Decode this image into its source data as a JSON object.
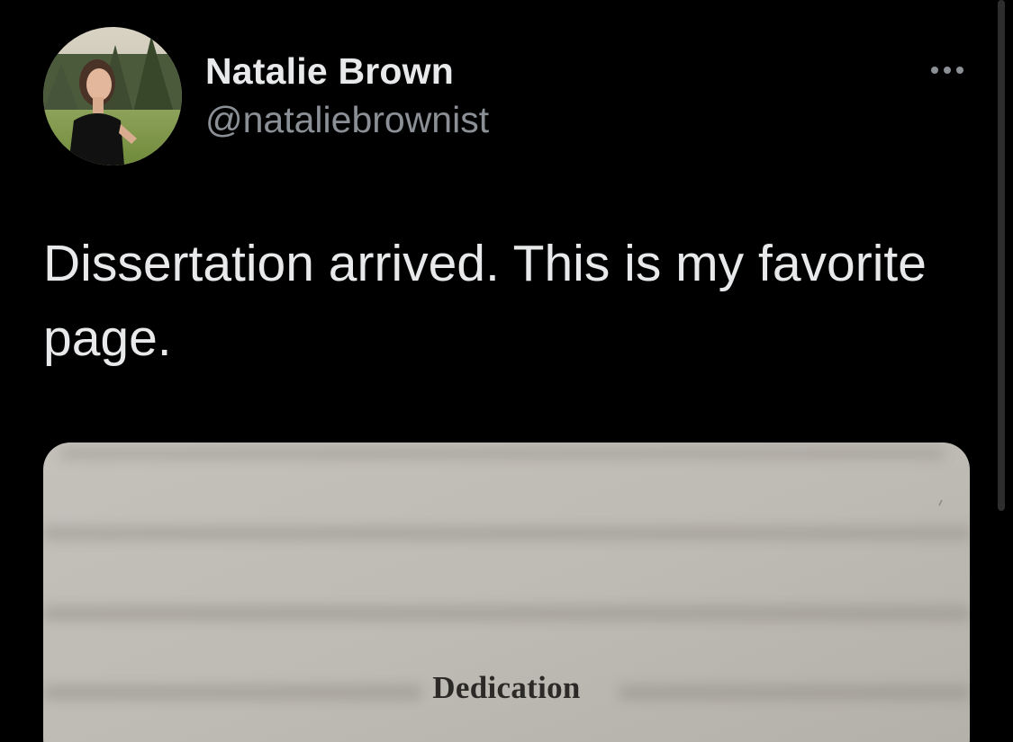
{
  "author": {
    "display_name": "Natalie Brown",
    "handle": "@nataliebrownist"
  },
  "more_menu": {
    "icon": "more-horizontal-icon"
  },
  "tweet": {
    "text": "Dissertation arrived. This is my favorite page."
  },
  "media": {
    "page_heading": "Dedication"
  },
  "colors": {
    "background": "#000000",
    "primary_text": "#e7e9ea",
    "secondary_text": "#8b9096",
    "paper": "#bdbab3"
  }
}
